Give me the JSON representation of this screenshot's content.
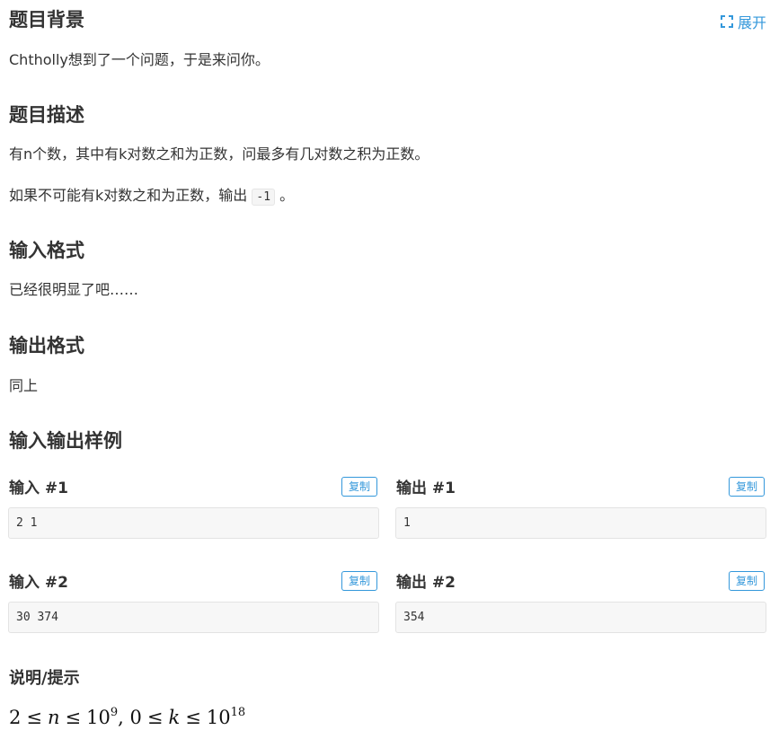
{
  "expand_label": "展开",
  "background": {
    "title": "题目背景",
    "text": "Chtholly想到了一个问题，于是来问你。"
  },
  "description": {
    "title": "题目描述",
    "line1": "有n个数，其中有k对数之和为正数，问最多有几对数之积为正数。",
    "line2_prefix": "如果不可能有k对数之和为正数，输出",
    "line2_code": "-1",
    "line2_suffix": "。"
  },
  "input_format": {
    "title": "输入格式",
    "text": "已经很明显了吧……"
  },
  "output_format": {
    "title": "输出格式",
    "text": "同上"
  },
  "samples": {
    "title": "输入输出样例",
    "copy_label": "复制",
    "items": [
      {
        "in_title": "输入 #1",
        "in": "2 1",
        "out_title": "输出 #1",
        "out": "1"
      },
      {
        "in_title": "输入 #2",
        "in": "30 374",
        "out_title": "输出 #2",
        "out": "354"
      }
    ]
  },
  "hint": {
    "title": "说明/提示",
    "math": {
      "a": "2",
      "n": "n",
      "b": "10",
      "b_exp": "9",
      "c": "0",
      "k": "k",
      "d": "10",
      "d_exp": "18"
    }
  },
  "colors": {
    "accent": "#3498db",
    "text": "#333333",
    "code_bg": "#f7f7f7"
  }
}
